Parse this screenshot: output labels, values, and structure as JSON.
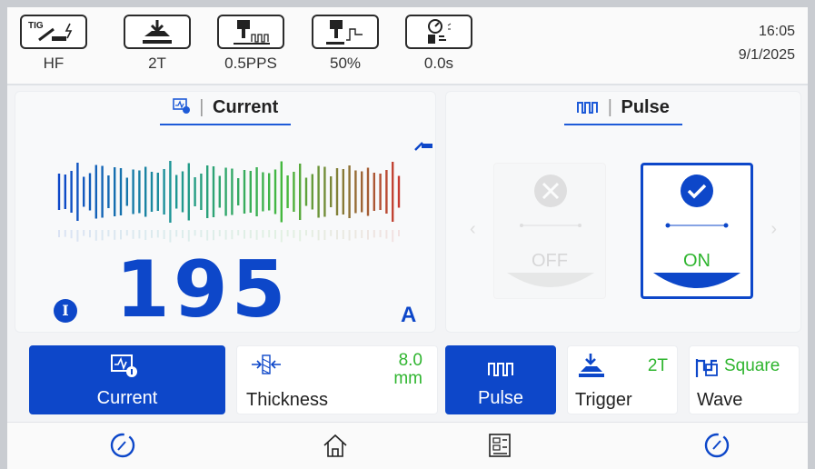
{
  "topbar": {
    "items": [
      {
        "icon": "tig-hf-icon",
        "tag": "TIG",
        "label": "HF"
      },
      {
        "icon": "trigger-2t-icon",
        "label": "2T"
      },
      {
        "icon": "pulse-frequency-icon",
        "label": "0.5PPS"
      },
      {
        "icon": "pulse-duty-icon",
        "label": "50%"
      },
      {
        "icon": "gas-timer-icon",
        "label": "0.0s"
      }
    ],
    "time": "16:05",
    "date": "9/1/2025"
  },
  "current_panel": {
    "title": "Current",
    "value": "195",
    "unit": "A",
    "badge": "I"
  },
  "pulse_panel": {
    "title": "Pulse",
    "off_label": "OFF",
    "on_label": "ON",
    "selected": "ON"
  },
  "tiles": {
    "current": {
      "label": "Current"
    },
    "thickness": {
      "label": "Thickness",
      "value": "8.0",
      "unit": "mm"
    },
    "pulse": {
      "label": "Pulse"
    },
    "trigger": {
      "label": "Trigger",
      "value": "2T"
    },
    "wave": {
      "label": "Wave",
      "value": "Square"
    }
  },
  "nav": {
    "items": [
      "dial-left-icon",
      "home-icon",
      "menu-grid-icon",
      "dial-right-icon"
    ]
  },
  "colors": {
    "accent": "#0d47c9",
    "value_green": "#2fb52f"
  }
}
